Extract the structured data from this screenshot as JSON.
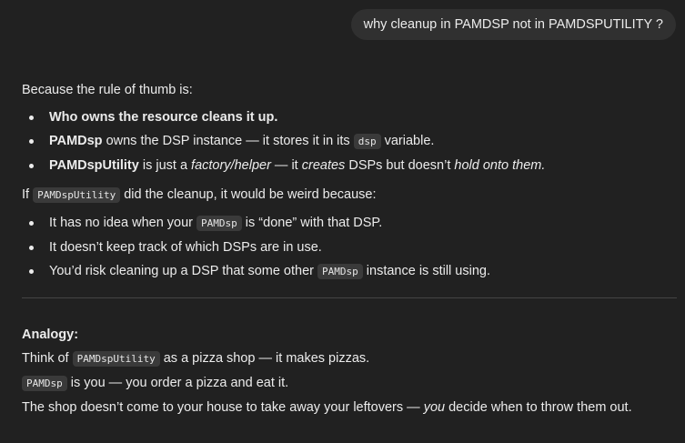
{
  "user_message": "why cleanup in PAMDSP not in PAMDSPUTILITY ?",
  "intro": "Because the rule of thumb is:",
  "rules": {
    "r1_bold": "Who owns the resource cleans it up.",
    "r2_bold": "PAMDsp",
    "r2_text": " owns the DSP instance — it stores it in its ",
    "r2_code": "dsp",
    "r2_end": " variable.",
    "r3_bold": "PAMDspUtility",
    "r3_text1": " is just a ",
    "r3_em1": "factory/helper",
    "r3_text2": " — it ",
    "r3_em2": "creates",
    "r3_text3": " DSPs but doesn’t ",
    "r3_em3": "hold onto them."
  },
  "if_line": {
    "pre": "If ",
    "code": "PAMDspUtility",
    "post": " did the cleanup, it would be weird because:"
  },
  "reasons": {
    "a_pre": "It has no idea when your ",
    "a_code": "PAMDsp",
    "a_post": " is “done” with that DSP.",
    "b": "It doesn’t keep track of which DSPs are in use.",
    "c_pre": "You’d risk cleaning up a DSP that some other ",
    "c_code": "PAMDsp",
    "c_post": " instance is still using."
  },
  "analogy": {
    "heading": "Analogy:",
    "l1_pre": "Think of ",
    "l1_code": "PAMDspUtility",
    "l1_post": " as a pizza shop — it makes pizzas.",
    "l2_code": "PAMDsp",
    "l2_post": " is you — you order a pizza and eat it.",
    "l3_pre": "The shop doesn’t come to your house to take away your leftovers — ",
    "l3_em": "you",
    "l3_post": " decide when to throw them out."
  }
}
